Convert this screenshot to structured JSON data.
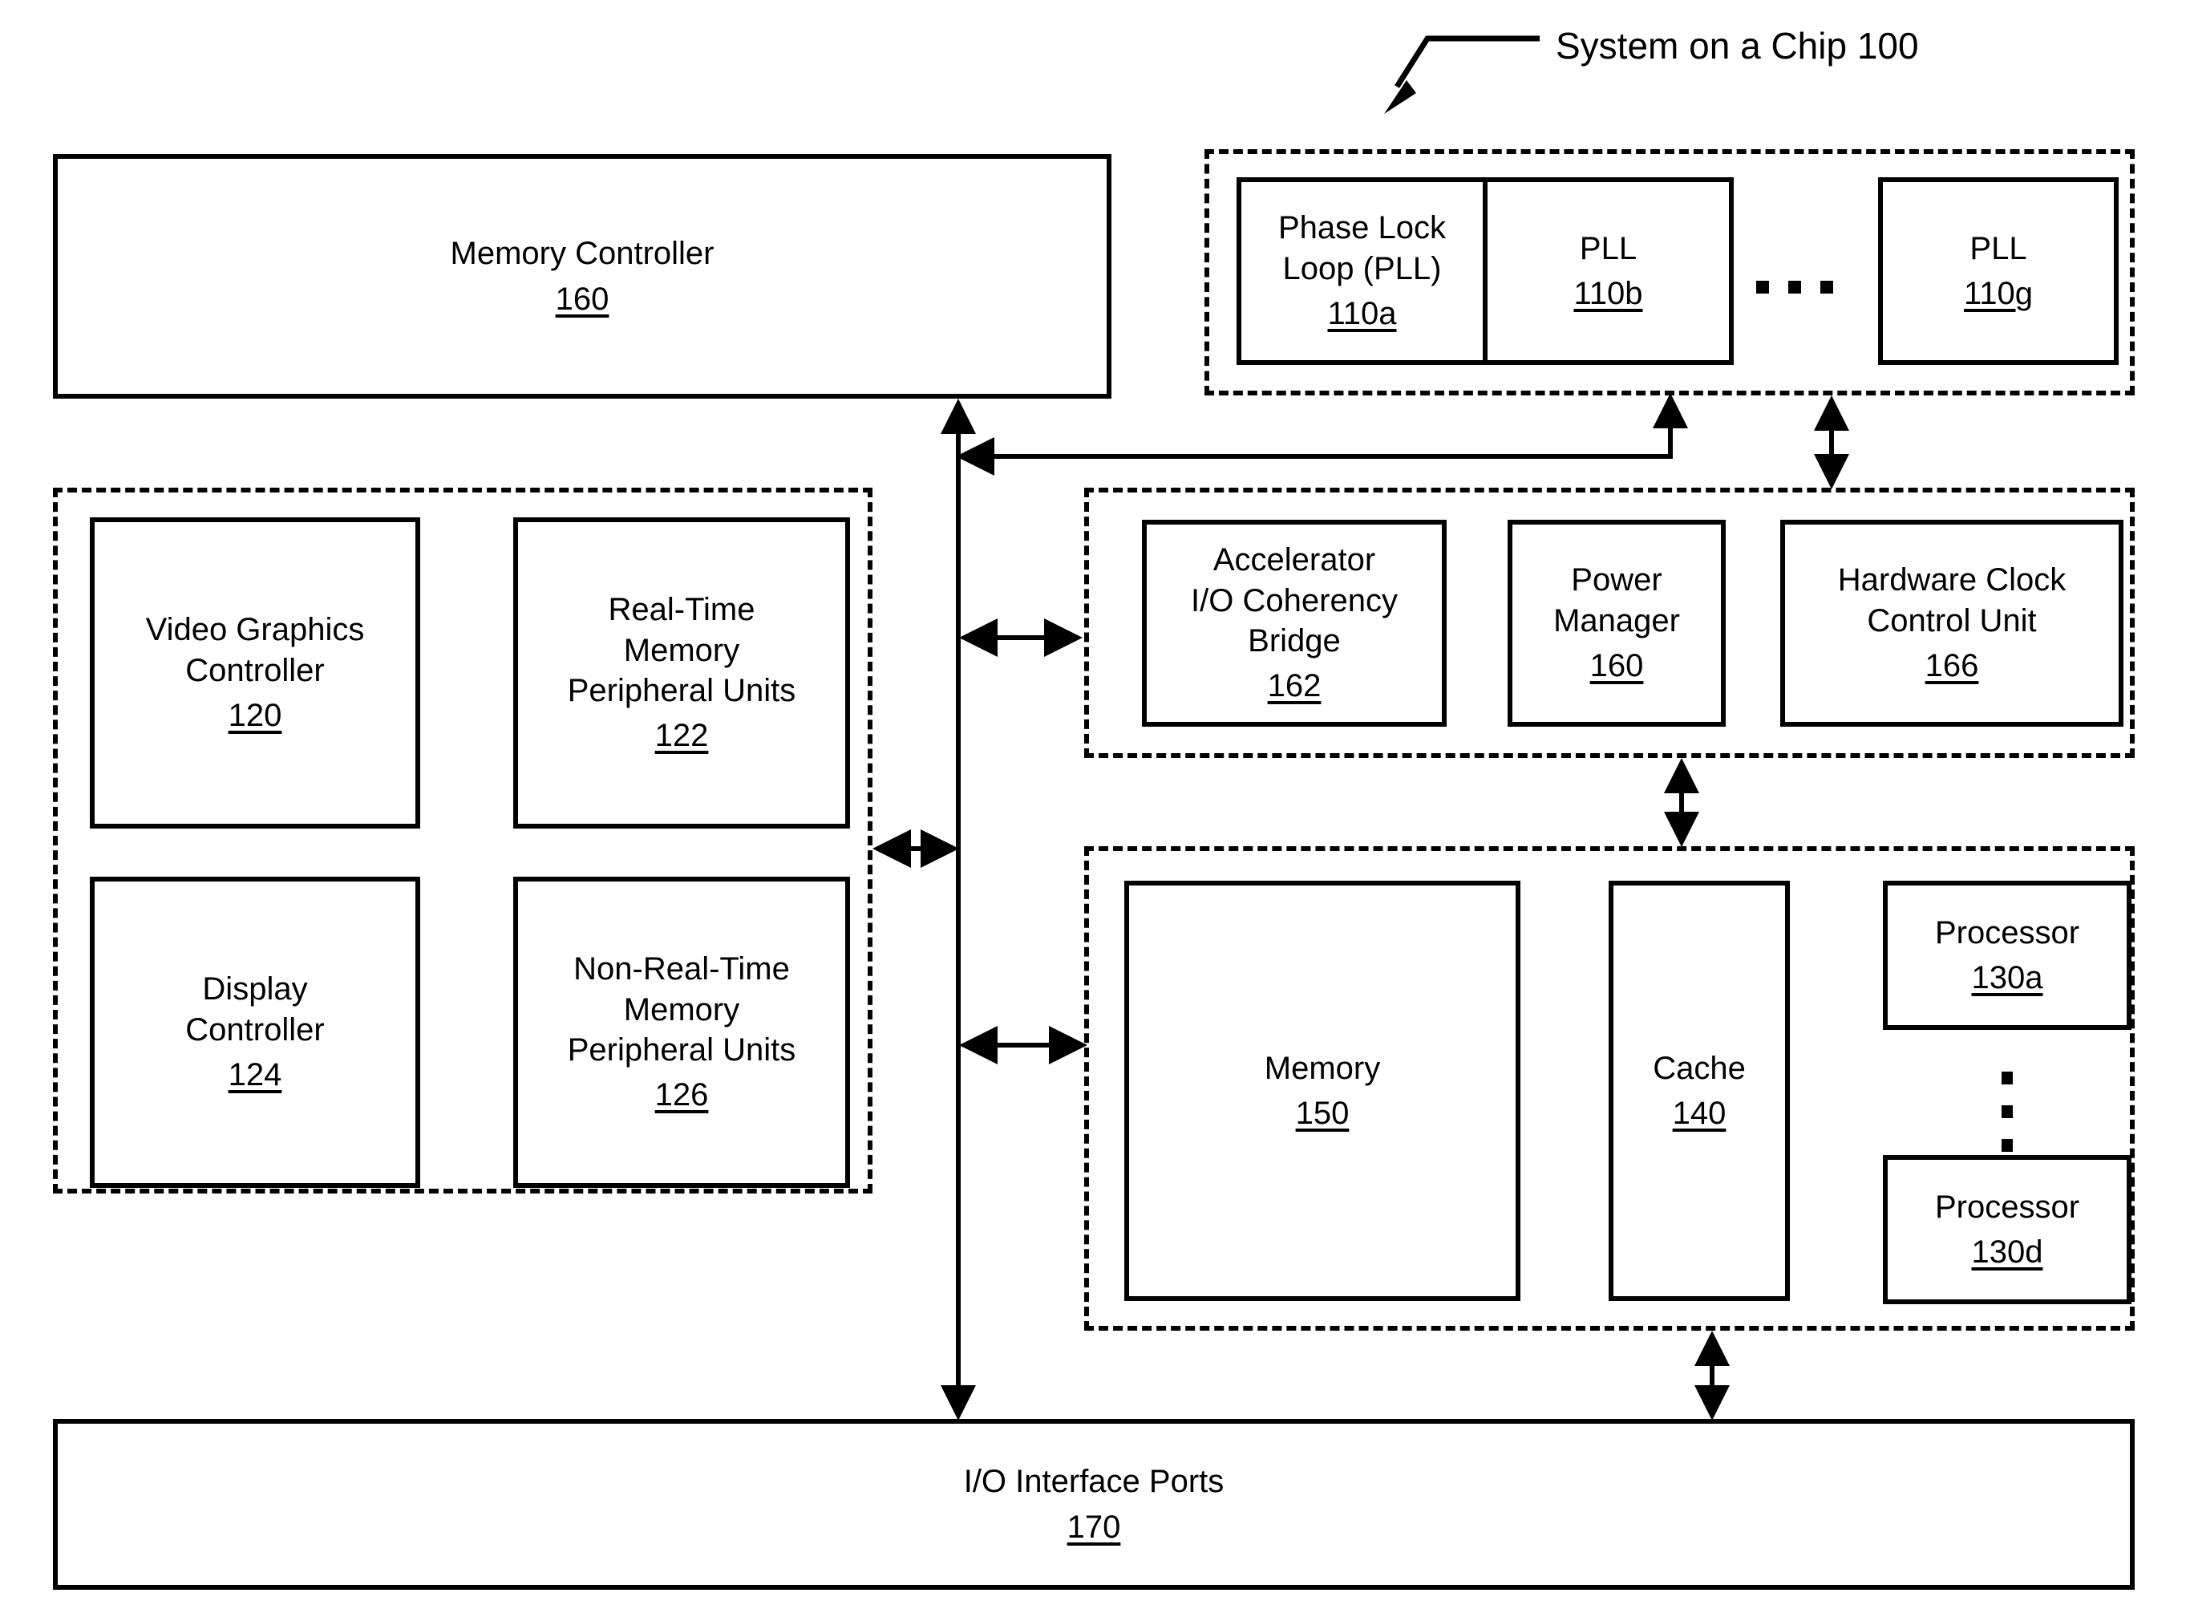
{
  "figure": {
    "callout": {
      "label": "System on a Chip 100",
      "target": "soc-pll-group"
    },
    "blocks": [
      {
        "id": "memory-controller",
        "title": "Memory Controller",
        "ref": "160"
      },
      {
        "id": "pll-110a",
        "title": "Phase Lock\nLoop (PLL)",
        "ref": "110a"
      },
      {
        "id": "pll-110b",
        "title": "PLL",
        "ref": "110b"
      },
      {
        "id": "pll-110g",
        "title": "PLL",
        "ref": "110g"
      },
      {
        "id": "video-graphics-controller",
        "title": "Video Graphics\nController",
        "ref": "120"
      },
      {
        "id": "real-time-memory-peripheral-units",
        "title": "Real-Time\nMemory\nPeripheral Units",
        "ref": "122"
      },
      {
        "id": "display-controller",
        "title": "Display\nController",
        "ref": "124"
      },
      {
        "id": "non-real-time-memory-peripheral-units",
        "title": "Non-Real-Time\nMemory\nPeripheral Units",
        "ref": "126"
      },
      {
        "id": "accelerator-io-coherency-bridge",
        "title": "Accelerator\nI/O Coherency\nBridge",
        "ref": "162"
      },
      {
        "id": "power-manager",
        "title": "Power\nManager",
        "ref": "160"
      },
      {
        "id": "hardware-clock-control-unit",
        "title": "Hardware Clock\nControl Unit",
        "ref": "166"
      },
      {
        "id": "memory",
        "title": "Memory",
        "ref": "150"
      },
      {
        "id": "cache",
        "title": "Cache",
        "ref": "140"
      },
      {
        "id": "processor-130a",
        "title": "Processor",
        "ref": "130a"
      },
      {
        "id": "processor-130d",
        "title": "Processor",
        "ref": "130d"
      },
      {
        "id": "io-interface-ports",
        "title": "I/O Interface Ports",
        "ref": "170"
      }
    ],
    "ellipsis": {
      "pll_horizontal": "...",
      "processor_vertical": "⋮"
    },
    "colors": {
      "line": "#000000",
      "background": "#ffffff"
    }
  }
}
